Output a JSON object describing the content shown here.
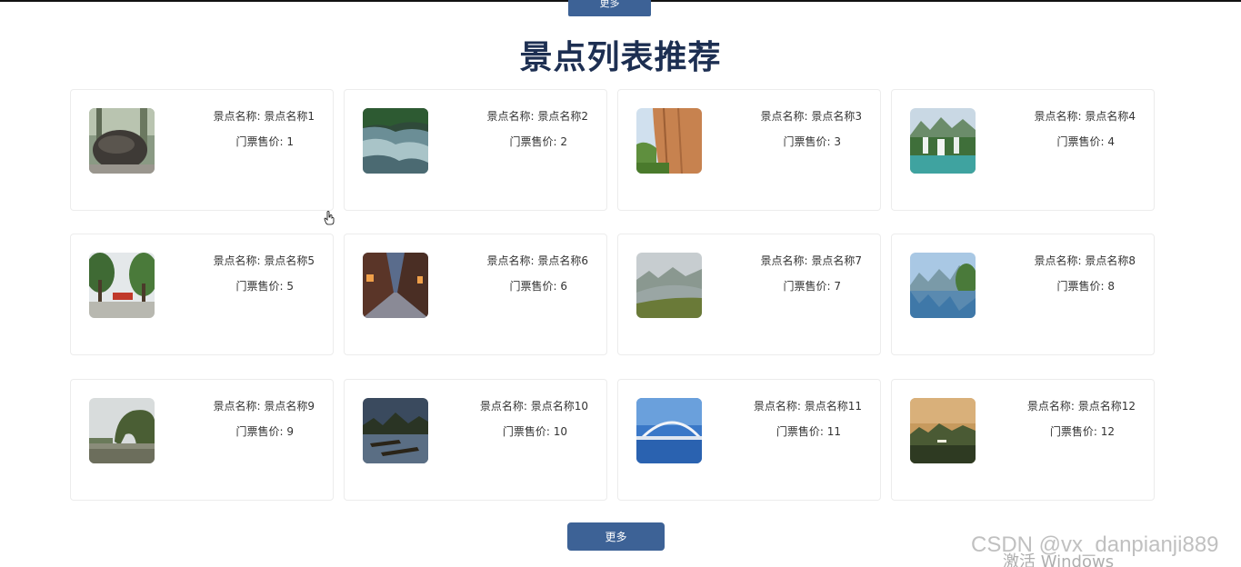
{
  "header": {
    "top_button_label": "更多",
    "title": "景点列表推荐"
  },
  "spots": [
    {
      "name_label": "景点名称:",
      "name": "景点名称1",
      "price_label": "门票售价:",
      "price": "1",
      "thumb": "rock-photo"
    },
    {
      "name_label": "景点名称:",
      "name": "景点名称2",
      "price_label": "门票售价:",
      "price": "2",
      "thumb": "river-rapids-photo"
    },
    {
      "name_label": "景点名称:",
      "name": "景点名称3",
      "price_label": "门票售价:",
      "price": "3",
      "thumb": "cliff-photo"
    },
    {
      "name_label": "景点名称:",
      "name": "景点名称4",
      "price_label": "门票售价:",
      "price": "4",
      "thumb": "waterfall-photo"
    },
    {
      "name_label": "景点名称:",
      "name": "景点名称5",
      "price_label": "门票售价:",
      "price": "5",
      "thumb": "park-photo"
    },
    {
      "name_label": "景点名称:",
      "name": "景点名称6",
      "price_label": "门票售价:",
      "price": "6",
      "thumb": "old-street-photo"
    },
    {
      "name_label": "景点名称:",
      "name": "景点名称7",
      "price_label": "门票售价:",
      "price": "7",
      "thumb": "misty-river-photo"
    },
    {
      "name_label": "景点名称:",
      "name": "景点名称8",
      "price_label": "门票售价:",
      "price": "8",
      "thumb": "lake-hills-photo"
    },
    {
      "name_label": "景点名称:",
      "name": "景点名称9",
      "price_label": "门票售价:",
      "price": "9",
      "thumb": "elephant-trunk-hill-photo"
    },
    {
      "name_label": "景点名称:",
      "name": "景点名称10",
      "price_label": "门票售价:",
      "price": "10",
      "thumb": "bamboo-rafts-photo"
    },
    {
      "name_label": "景点名称:",
      "name": "景点名称11",
      "price_label": "门票售价:",
      "price": "11",
      "thumb": "bridge-photo"
    },
    {
      "name_label": "景点名称:",
      "name": "景点名称12",
      "price_label": "门票售价:",
      "price": "12",
      "thumb": "sunset-karst-photo"
    }
  ],
  "footer": {
    "more_button_label": "更多",
    "watermark": "CSDN @vx_danpianji889",
    "os_notice": "激活 Windows"
  },
  "colors": {
    "title": "#1d2f52",
    "button": "#3d6296",
    "card_border": "#ececec"
  }
}
